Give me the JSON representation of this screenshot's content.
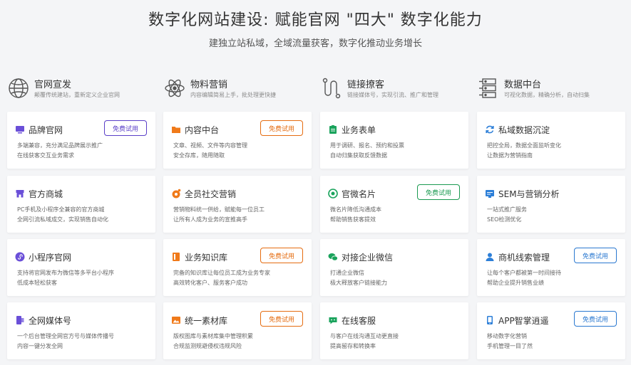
{
  "header": {
    "title": "数字化网站建设: 赋能官网 \"四大\" 数字化能力",
    "subtitle": "建独立站私域，全域流量获客，数字化推动业务增长"
  },
  "categories": [
    {
      "name": "官网宣发",
      "desc": "颠覆传统建站，重新定义企业官网",
      "icon": "globe-icon"
    },
    {
      "name": "物料营销",
      "desc": "内容编辑简易上手，批处理更快捷",
      "icon": "atom-icon"
    },
    {
      "name": "链接撩客",
      "desc": "链接媒体号，实现引流、推广和管理",
      "icon": "link-path-icon"
    },
    {
      "name": "数据中台",
      "desc": "可视化数据，精确分析，自动扫集",
      "icon": "server-icon"
    }
  ],
  "trial_label": "免费试用",
  "colors": {
    "purple": "#6a4fd8",
    "orange": "#f07a1a",
    "green": "#1aa35c",
    "blue": "#2d7fd8",
    "trial_purple": "#5a3fc8",
    "trial_orange": "#e56c10",
    "trial_green": "#1a9a50",
    "trial_blue": "#2a78d0"
  },
  "columns": [
    {
      "cards": [
        {
          "name": "品牌官网",
          "d1": "多端兼容，充分满足品牌展示推广",
          "d2": "在线获客交互业务需求",
          "icon": "monitor-icon",
          "trial": true
        },
        {
          "name": "官方商城",
          "d1": "PC手机及小程序全兼容的官方商城",
          "d2": "全网引流私域成交，实现销售自动化",
          "icon": "store-icon",
          "trial": false
        },
        {
          "name": "小程序官网",
          "d1": "支持将官网发布为微信等多平台小程序",
          "d2": "低成本轻松获客",
          "icon": "mini-program-icon",
          "trial": false
        },
        {
          "name": "全网媒体号",
          "d1": "一个后台管理全网官方号与媒体传播号",
          "d2": "内容一键分发全网",
          "icon": "media-icon",
          "trial": false
        }
      ]
    },
    {
      "cards": [
        {
          "name": "内容中台",
          "d1": "文章、视频、文件等内容管理",
          "d2": "安全存库，随用随取",
          "icon": "folder-icon",
          "trial": true
        },
        {
          "name": "全员社交营销",
          "d1": "营销物料统一供给，赋能每一位员工",
          "d2": "让所有人成为业务的宣推高手",
          "icon": "share-icon",
          "trial": false
        },
        {
          "name": "业务知识库",
          "d1": "完备的知识库让每位员工成为业务专家",
          "d2": "高效转化客户、服务客户成功",
          "icon": "book-icon",
          "trial": true
        },
        {
          "name": "统一素材库",
          "d1": "版权图库与素材库集中管理积累",
          "d2": "合规监测规避侵权违规风险",
          "icon": "image-library-icon",
          "trial": true
        }
      ]
    },
    {
      "cards": [
        {
          "name": "业务表单",
          "d1": "用于调研、报名、预约和投票",
          "d2": "自动归集获取反馈数据",
          "icon": "clipboard-icon",
          "trial": false
        },
        {
          "name": "官微名片",
          "d1": "微名片降低沟通成本",
          "d2": "帮助销售获客提效",
          "icon": "card-icon",
          "trial": true
        },
        {
          "name": "对接企业微信",
          "d1": "打通企业微信",
          "d2": "极大释放客户链接能力",
          "icon": "wechat-icon",
          "trial": false
        },
        {
          "name": "在线客服",
          "d1": "与客户在线沟通互动更直接",
          "d2": "提高留存和转换率",
          "icon": "chat-icon",
          "trial": false
        }
      ]
    },
    {
      "cards": [
        {
          "name": "私域数据沉淀",
          "d1": "把控全局，数据全面监听变化",
          "d2": "让数据为营销指南",
          "icon": "refresh-icon",
          "trial": false
        },
        {
          "name": "SEM与营销分析",
          "d1": "一站式推广服务",
          "d2": "SEO检测优化",
          "icon": "analytics-icon",
          "trial": false
        },
        {
          "name": "商机线索管理",
          "d1": "让每个客户都被第一时间接待",
          "d2": "帮助企业提升销售业绩",
          "icon": "user-icon",
          "trial": true
        },
        {
          "name": "APP智掌逍遥",
          "d1": "移动数字化营销",
          "d2": "手机管理一目了然",
          "icon": "phone-icon",
          "trial": true
        }
      ]
    }
  ]
}
